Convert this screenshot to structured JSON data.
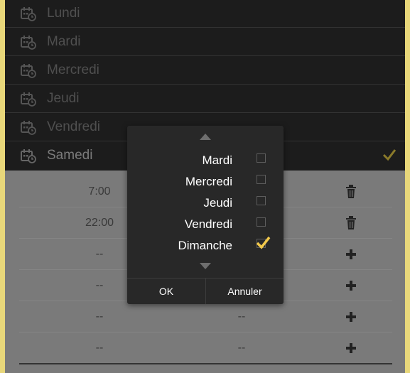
{
  "days": [
    {
      "label": "Lundi"
    },
    {
      "label": "Mardi"
    },
    {
      "label": "Mercredi"
    },
    {
      "label": "Jeudi"
    },
    {
      "label": "Vendredi"
    },
    {
      "label": "Samedi",
      "checked": true
    }
  ],
  "time_rows": [
    {
      "start": "7:00",
      "end": "",
      "action": "trash-icon"
    },
    {
      "start": "22:00",
      "end": "",
      "action": "trash-icon"
    },
    {
      "start": "--",
      "end": "",
      "action": "plus-icon"
    },
    {
      "start": "--",
      "end": "",
      "action": "plus-icon"
    },
    {
      "start": "--",
      "end": "--",
      "action": "plus-icon"
    },
    {
      "start": "--",
      "end": "--",
      "action": "plus-icon"
    }
  ],
  "dialog": {
    "options": [
      {
        "label": "Mardi",
        "checked": false
      },
      {
        "label": "Mercredi",
        "checked": false
      },
      {
        "label": "Jeudi",
        "checked": false
      },
      {
        "label": "Vendredi",
        "checked": false
      },
      {
        "label": "Dimanche",
        "checked": true
      }
    ],
    "ok_label": "OK",
    "cancel_label": "Annuler"
  },
  "colors": {
    "accent": "#f2c94c",
    "frame": "#e8d77a",
    "list_bg": "#1c1c1c",
    "panel_bg": "#7a7a7a",
    "dialog_bg": "#282828"
  }
}
